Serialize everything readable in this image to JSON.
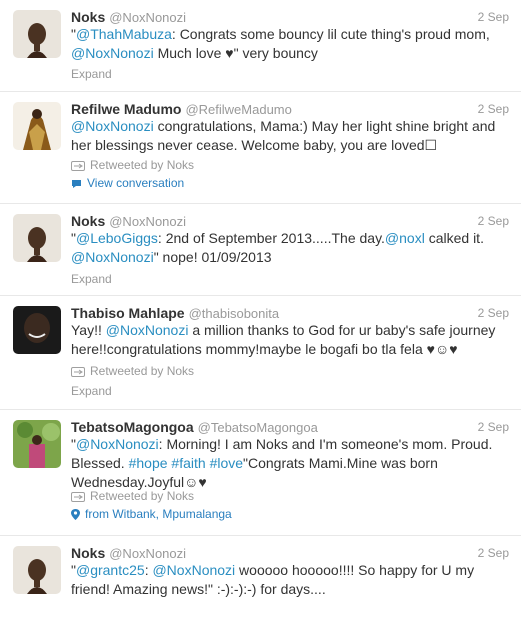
{
  "tweets": [
    {
      "name": "Noks",
      "handle": "@NoxNonozi",
      "time": "2 Sep",
      "parts": [
        "\"",
        "@ThahMabuza",
        ": Congrats some bouncy lil cute thing's proud mom, ",
        "@NoxNonozi",
        " Much love ♥\" very bouncy"
      ],
      "action": "Expand"
    },
    {
      "name": "Refilwe Madumo",
      "handle": "@RefilweMadumo",
      "time": "2 Sep",
      "parts": [
        "@NoxNonozi",
        " congratulations, Mama:) May her light shine bright and her blessings never cease. Welcome baby, you are loved☐"
      ],
      "retweet": "Retweeted by Noks",
      "action": "View conversation"
    },
    {
      "name": "Noks",
      "handle": "@NoxNonozi",
      "time": "2 Sep",
      "parts": [
        "\"",
        "@LeboGiggs",
        ": 2nd of September 2013.....The day.",
        "@noxl",
        " calked it. ",
        "@NoxNonozi",
        "\" nope! 01/09/2013"
      ],
      "action": "Expand"
    },
    {
      "name": "Thabiso Mahlape",
      "handle": "@thabisobonita",
      "time": "2 Sep",
      "parts": [
        "Yay!! ",
        "@NoxNonozi",
        " a million thanks to God for ur baby's safe journey here!!congratulations mommy!maybe le bogafi bo tla fela ♥☺♥"
      ],
      "retweet": "Retweeted by Noks",
      "action": "Expand"
    },
    {
      "name": "TebatsoMagongoa",
      "handle": "@TebatsoMagongoa",
      "time": "2 Sep",
      "parts": [
        "\"",
        "@NoxNonozi",
        ": Morning! I am Noks and I'm someone's mom. Proud. Blessed. ",
        "#hope",
        " ",
        "#faith",
        " ",
        "#love",
        "\"Congrats Mami.Mine was born Wednesday.Joyful☺♥"
      ],
      "retweet": "Retweeted by Noks",
      "action": "from Witbank, Mpumalanga"
    },
    {
      "name": "Noks",
      "handle": "@NoxNonozi",
      "time": "2 Sep",
      "parts": [
        "\"",
        "@grantc25",
        ": ",
        "@NoxNonozi",
        " wooooo hooooo!!!! So happy for U my friend! Amazing news!\" :-):-):-) for days...."
      ]
    }
  ],
  "colors": {
    "link": "#2a8ec1",
    "name": "#333333",
    "muted": "#999999"
  }
}
